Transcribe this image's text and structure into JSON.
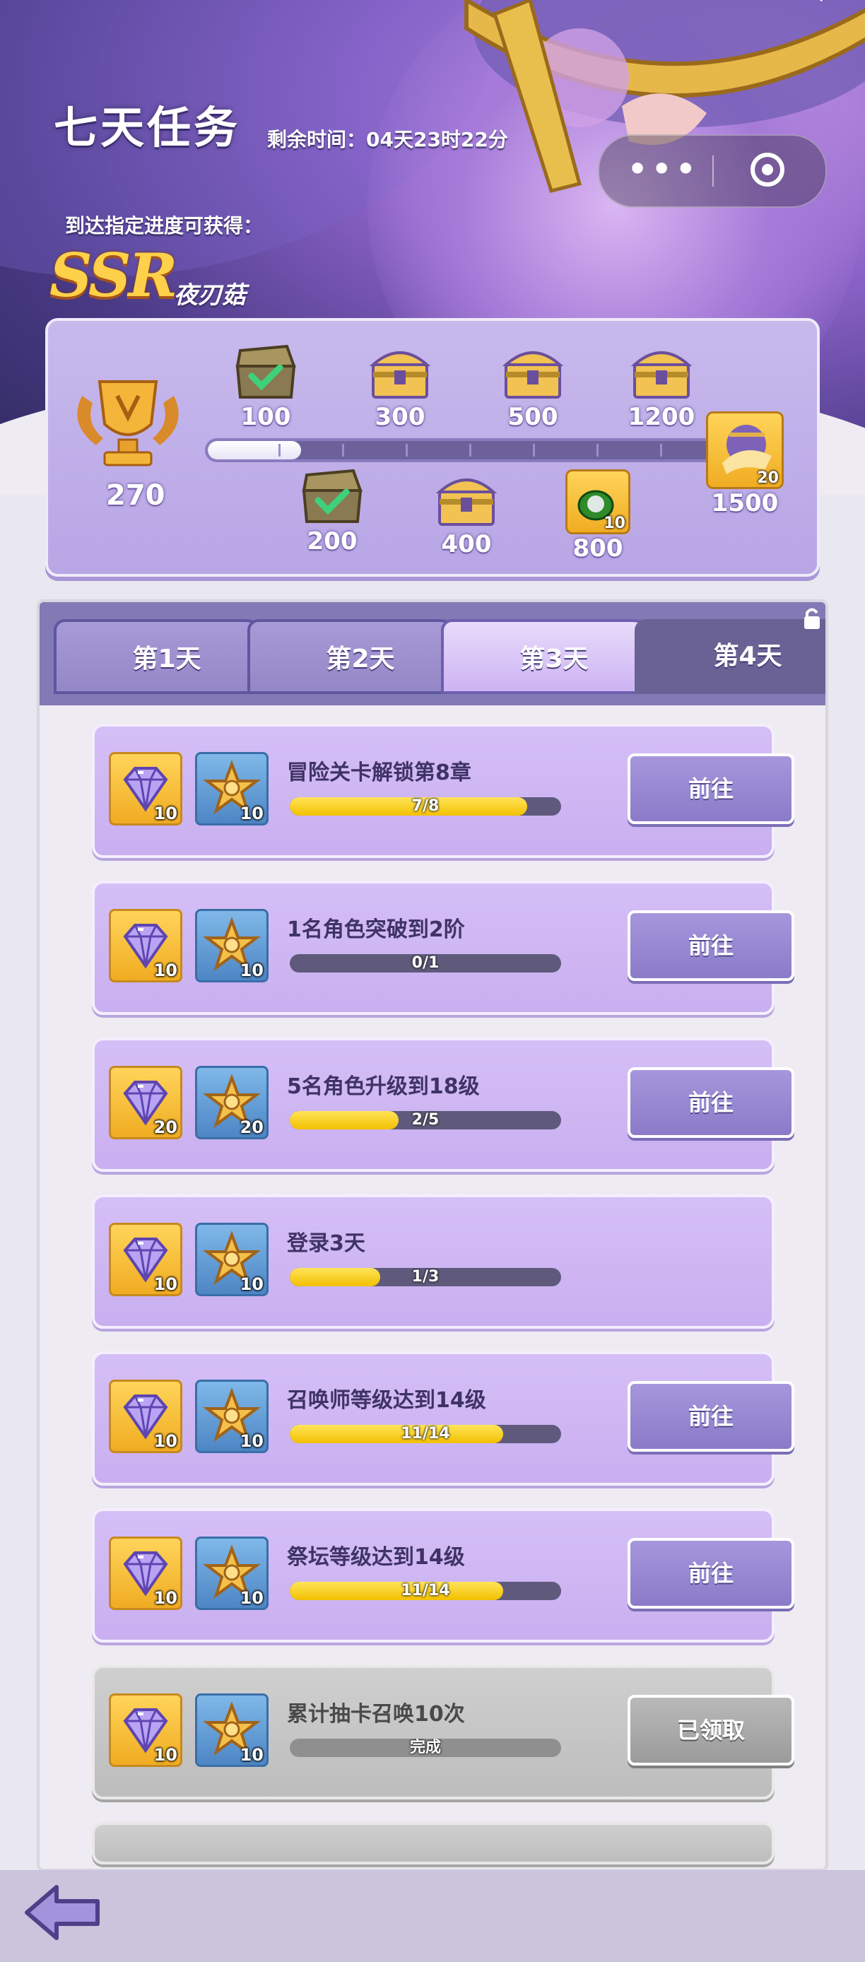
{
  "header": {
    "title": "七天任务",
    "remaining": "剩余时间：04天23时22分",
    "subtitle": "到达指定进度可获得：",
    "reward_rank": "SSR",
    "reward_name": "夜刃菇"
  },
  "capsule": {
    "more": "•••"
  },
  "progress": {
    "current": "270",
    "fill_ratio": 0.18,
    "milestones_top": [
      {
        "label": "100",
        "kind": "chest-open-claimed"
      },
      {
        "label": "300",
        "kind": "chest"
      },
      {
        "label": "500",
        "kind": "chest"
      },
      {
        "label": "1200",
        "kind": "chest"
      }
    ],
    "milestones_bottom": [
      {
        "label": "200",
        "kind": "chest-open-claimed"
      },
      {
        "label": "400",
        "kind": "chest"
      },
      {
        "label": "800",
        "kind": "green-orb-item",
        "count": "10"
      }
    ],
    "final": {
      "label": "1500",
      "count": "20"
    }
  },
  "tabs": [
    {
      "label": "第1天",
      "state": "inactive"
    },
    {
      "label": "第2天",
      "state": "inactive"
    },
    {
      "label": "第3天",
      "state": "active"
    },
    {
      "label": "第4天",
      "state": "locked"
    }
  ],
  "tasks": [
    {
      "title": "冒险关卡解锁第8章",
      "gem": "10",
      "star": "10",
      "progress": "7/8",
      "ratio": 0.875,
      "button": "前往",
      "done": false
    },
    {
      "title": "1名角色突破到2阶",
      "gem": "10",
      "star": "10",
      "progress": "0/1",
      "ratio": 0,
      "button": "前往",
      "done": false
    },
    {
      "title": "5名角色升级到18级",
      "gem": "20",
      "star": "20",
      "progress": "2/5",
      "ratio": 0.4,
      "button": "前往",
      "done": false
    },
    {
      "title": "登录3天",
      "gem": "10",
      "star": "10",
      "progress": "1/3",
      "ratio": 0.333,
      "button": "",
      "done": false
    },
    {
      "title": "召唤师等级达到14级",
      "gem": "10",
      "star": "10",
      "progress": "11/14",
      "ratio": 0.786,
      "button": "前往",
      "done": false
    },
    {
      "title": "祭坛等级达到14级",
      "gem": "10",
      "star": "10",
      "progress": "11/14",
      "ratio": 0.786,
      "button": "前往",
      "done": false
    },
    {
      "title": "累计抽卡召唤10次",
      "gem": "10",
      "star": "10",
      "progress": "完成",
      "ratio": 0,
      "button": "已领取",
      "done": true
    }
  ]
}
